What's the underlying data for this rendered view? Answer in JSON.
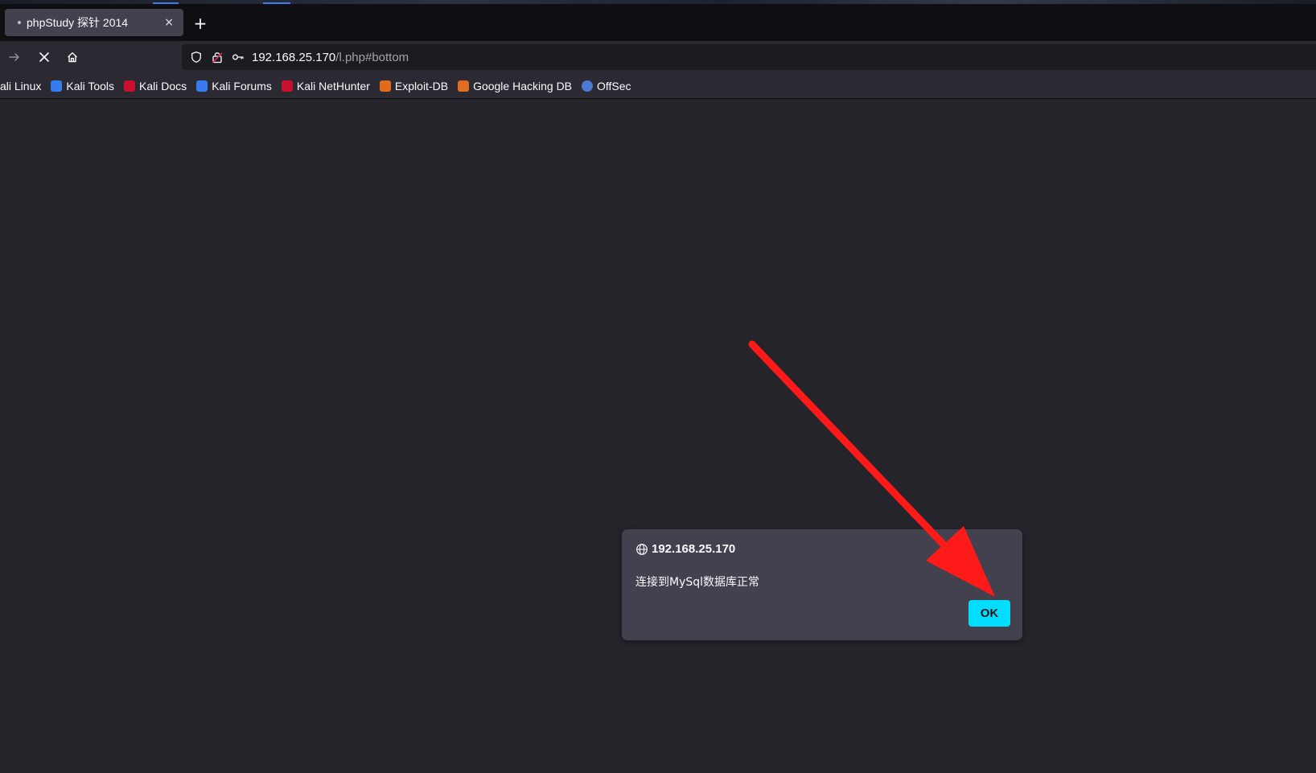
{
  "browser": {
    "tab": {
      "title": "phpStudy 探针 2014",
      "close_glyph": "×"
    },
    "new_tab_glyph": "+",
    "url": {
      "host": "192.168.25.170",
      "path": "/l.php#bottom"
    },
    "bookmarks": [
      {
        "label": "ali Linux",
        "icon": "kali-icon",
        "color": "#367bf0"
      },
      {
        "label": "Kali Tools",
        "icon": "kali-tools-icon",
        "color": "#367bf0"
      },
      {
        "label": "Kali Docs",
        "icon": "kali-docs-icon",
        "color": "#c8102e"
      },
      {
        "label": "Kali Forums",
        "icon": "kali-forums-icon",
        "color": "#367bf0"
      },
      {
        "label": "Kali NetHunter",
        "icon": "kali-nethunter-icon",
        "color": "#c8102e"
      },
      {
        "label": "Exploit-DB",
        "icon": "exploit-db-icon",
        "color": "#e06c1f"
      },
      {
        "label": "Google Hacking DB",
        "icon": "ghdb-icon",
        "color": "#e06c1f"
      },
      {
        "label": "OffSec",
        "icon": "offsec-icon",
        "color": "#4a7bd1"
      }
    ]
  },
  "dialog": {
    "origin": "192.168.25.170",
    "message": "连接到MySql数据库正常",
    "ok_label": "OK",
    "accent_color": "#00ddff"
  },
  "annotation": {
    "type": "arrow",
    "color": "#ff1a1a",
    "target": "ok-button"
  }
}
